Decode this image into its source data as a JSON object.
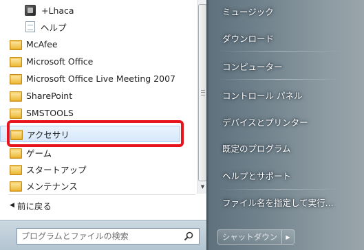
{
  "programs": [
    {
      "label": "+Lhaca",
      "icon": "app-icon",
      "indent": "sub"
    },
    {
      "label": "ヘルプ",
      "icon": "document-icon",
      "indent": "sub"
    },
    {
      "label": "McAfee",
      "icon": "folder-icon",
      "indent": "top"
    },
    {
      "label": "Microsoft Office",
      "icon": "folder-icon",
      "indent": "top"
    },
    {
      "label": "Microsoft Office Live Meeting 2007",
      "icon": "folder-icon",
      "indent": "top"
    },
    {
      "label": "SharePoint",
      "icon": "folder-icon",
      "indent": "top"
    },
    {
      "label": "SMSTOOLS",
      "icon": "folder-icon",
      "indent": "top"
    },
    {
      "label": "アクセサリ",
      "icon": "folder-icon",
      "indent": "top",
      "selected": true
    },
    {
      "label": "ゲーム",
      "icon": "folder-icon",
      "indent": "top"
    },
    {
      "label": "スタートアップ",
      "icon": "folder-icon",
      "indent": "top"
    },
    {
      "label": "メンテナンス",
      "icon": "folder-icon",
      "indent": "top"
    }
  ],
  "back": {
    "label": "前に戻る",
    "icon": "back-arrow-icon"
  },
  "search": {
    "placeholder": "プログラムとファイルの検索",
    "icon": "search-icon"
  },
  "right_menu": [
    {
      "label": "ミュージック"
    },
    {
      "label": "ダウンロード"
    },
    {
      "label": "コンピューター"
    },
    {
      "label": "コントロール パネル"
    },
    {
      "label": "デバイスとプリンター"
    },
    {
      "label": "既定のプログラム"
    },
    {
      "label": "ヘルプとサポート"
    },
    {
      "label": "ファイル名を指定して実行..."
    }
  ],
  "shutdown": {
    "label": "シャットダウン",
    "arrow_icon": "chevron-right-icon"
  },
  "colors": {
    "highlight_box": "#e8141c",
    "selection_bg": "#d6e8fb"
  }
}
